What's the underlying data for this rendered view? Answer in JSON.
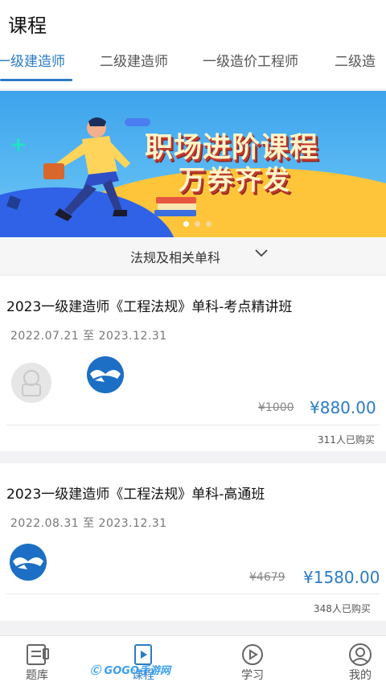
{
  "header": {
    "title": "课程"
  },
  "tabs": [
    {
      "label": "一级建造师",
      "active": true
    },
    {
      "label": "二级建造师",
      "active": false
    },
    {
      "label": "一级造价工程师",
      "active": false
    },
    {
      "label": "二级造",
      "active": false
    }
  ],
  "banner": {
    "line1": "职场进阶课程",
    "line2": "万券齐发",
    "page_dots": 3,
    "current_dot": 1
  },
  "filter": {
    "label": "法规及相关单科"
  },
  "courses": [
    {
      "title": "2023一级建造师《工程法规》单科-考点精讲班",
      "date": "2022.07.21 至 2023.12.31",
      "old_price": "¥1000",
      "price": "¥880.00",
      "buyers": "311人已购买"
    },
    {
      "title": "2023一级建造师《工程法规》单科-高通班",
      "date": "2022.08.31 至 2023.12.31",
      "old_price": "¥4679",
      "price": "¥1580.00",
      "buyers": "348人已购买"
    }
  ],
  "tabbar": [
    {
      "label": "题库",
      "icon": "question-bank-icon",
      "active": false
    },
    {
      "label": "课程",
      "icon": "course-play-icon",
      "active": true
    },
    {
      "label": "学习",
      "icon": "study-play-icon",
      "active": false
    },
    {
      "label": "我的",
      "icon": "profile-icon",
      "active": false
    }
  ],
  "watermark": "GOGO手游网",
  "colors": {
    "accent": "#2a7bc8",
    "banner_bg": "#4aaef0",
    "banner_yellow": "#ffc53a"
  }
}
